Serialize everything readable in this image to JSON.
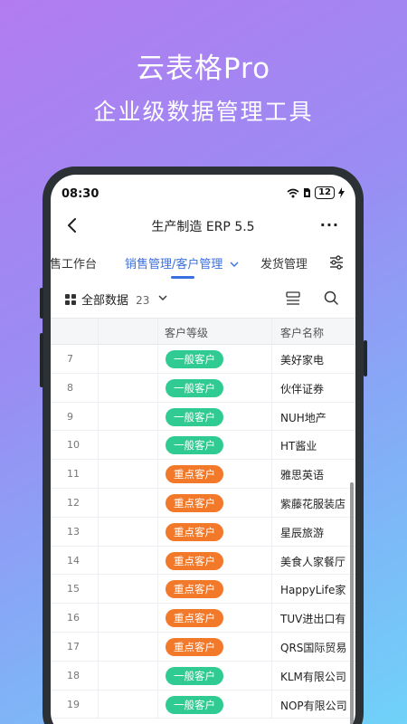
{
  "promo": {
    "title": "云表格Pro",
    "subtitle": "企业级数据管理工具"
  },
  "status_bar": {
    "time": "08:30",
    "battery": "12"
  },
  "nav": {
    "title": "生产制造 ERP 5.5",
    "more": "···"
  },
  "tabs": [
    {
      "label": "销售工作台",
      "active": false
    },
    {
      "label": "销售管理/客户管理",
      "active": true
    },
    {
      "label": "发货管理",
      "active": false
    }
  ],
  "toolbar": {
    "view_label": "全部数据",
    "view_count": "23"
  },
  "table": {
    "columns": [
      "客户等级",
      "客户名称"
    ],
    "rows": [
      {
        "num": "7",
        "level": "一般客户",
        "type": "general",
        "name": "美好家电"
      },
      {
        "num": "8",
        "level": "一般客户",
        "type": "general",
        "name": "伙伴证券"
      },
      {
        "num": "9",
        "level": "一般客户",
        "type": "general",
        "name": "NUH地产"
      },
      {
        "num": "10",
        "level": "一般客户",
        "type": "general",
        "name": "HT酱业"
      },
      {
        "num": "11",
        "level": "重点客户",
        "type": "key",
        "name": "雅思英语"
      },
      {
        "num": "12",
        "level": "重点客户",
        "type": "key",
        "name": "紫藤花服装店"
      },
      {
        "num": "13",
        "level": "重点客户",
        "type": "key",
        "name": "星辰旅游"
      },
      {
        "num": "14",
        "level": "重点客户",
        "type": "key",
        "name": "美食人家餐厅"
      },
      {
        "num": "15",
        "level": "重点客户",
        "type": "key",
        "name": "HappyLife家"
      },
      {
        "num": "16",
        "level": "重点客户",
        "type": "key",
        "name": "TUV进出口有"
      },
      {
        "num": "17",
        "level": "重点客户",
        "type": "key",
        "name": "QRS国际贸易"
      },
      {
        "num": "18",
        "level": "一般客户",
        "type": "general",
        "name": "KLM有限公司"
      },
      {
        "num": "19",
        "level": "一般客户",
        "type": "general",
        "name": "NOP有限公司"
      }
    ]
  },
  "colors": {
    "accent": "#3a6fe0",
    "general_badge": "#2fcb93",
    "key_badge": "#f2792a"
  }
}
